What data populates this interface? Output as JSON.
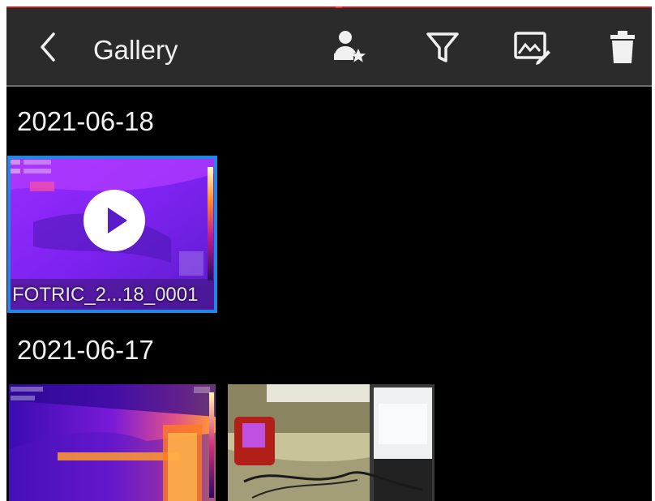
{
  "header": {
    "title": "Gallery",
    "icons": [
      "back-arrow-icon",
      "favorite-user-icon",
      "filter-icon",
      "edit-image-icon",
      "trash-icon"
    ]
  },
  "groups": [
    {
      "date": "2021-06-18",
      "items": [
        {
          "filename": "FOTRIC_2...18_0001",
          "type": "video",
          "selected": true
        }
      ]
    },
    {
      "date": "2021-06-17",
      "items": [
        {
          "filename": "",
          "type": "thermal-image",
          "selected": false
        },
        {
          "filename": "",
          "type": "photo",
          "selected": false
        }
      ]
    }
  ],
  "colors": {
    "selection": "#1e88e5",
    "topbar": "#2b2b2b",
    "background": "#000000"
  }
}
